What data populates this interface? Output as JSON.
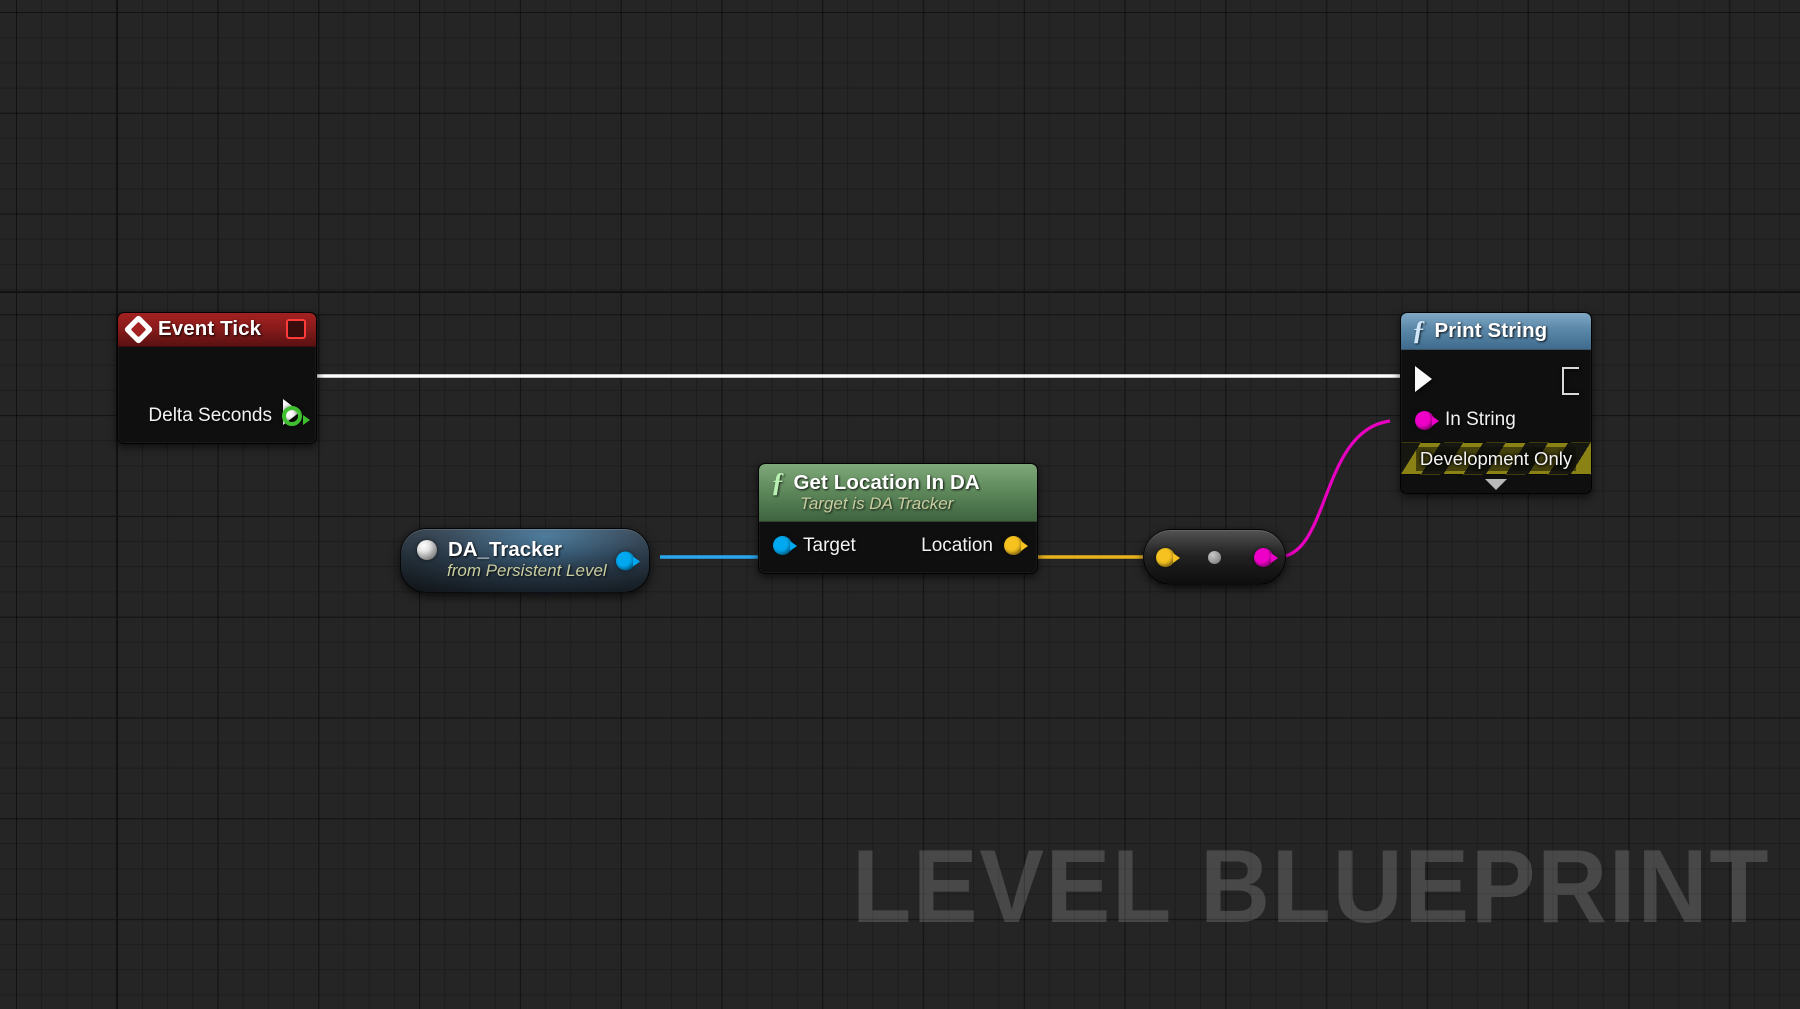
{
  "canvas": {
    "watermark": "LEVEL BLUEPRINT",
    "background_color": "#252525",
    "grid_minor_color": "#1d1d1d",
    "grid_major_color": "#171717"
  },
  "nodes": {
    "event_tick": {
      "title": "Event Tick",
      "header_color": "#8d1c1c",
      "icon": "event-diamond-icon",
      "stop_badge": "event-stop-badge",
      "exec_out_label": "",
      "output_pin_label": "Delta Seconds",
      "output_pin_color": "#3fbf2f"
    },
    "da_tracker": {
      "title": "DA_Tracker",
      "subtitle": "from Persistent Level",
      "icon": "object-sphere-icon",
      "output_pin_color": "#00a8f0"
    },
    "get_location": {
      "title": "Get Location In DA",
      "subtitle": "Target is DA Tracker",
      "header_color": "#5f8a5c",
      "icon": "function-f-icon",
      "input_pin_label": "Target",
      "input_pin_color": "#00a8f0",
      "output_pin_label": "Location",
      "output_pin_color": "#f5c220"
    },
    "convert_node": {
      "title": "",
      "input_pin_color": "#f5c220",
      "mid_dot": "conversion-dot-icon",
      "output_pin_color": "#ef00c8"
    },
    "print_string": {
      "title": "Print String",
      "header_color": "#5b87a8",
      "icon": "function-f-icon",
      "input_pin_label": "In String",
      "input_pin_color": "#ef00c8",
      "dev_only_label": "Development Only",
      "expand_icon": "chevron-down-icon"
    }
  },
  "wires": [
    {
      "name": "exec-wire-tick-to-print",
      "color": "#ffffff",
      "type": "exec"
    },
    {
      "name": "object-wire-tracker-to-target",
      "color": "#29a8ef",
      "type": "object"
    },
    {
      "name": "vector-wire-location-to-convert",
      "color": "#e8b41d",
      "type": "vector"
    },
    {
      "name": "string-wire-convert-to-instring",
      "color": "#e800c0",
      "type": "string"
    }
  ]
}
